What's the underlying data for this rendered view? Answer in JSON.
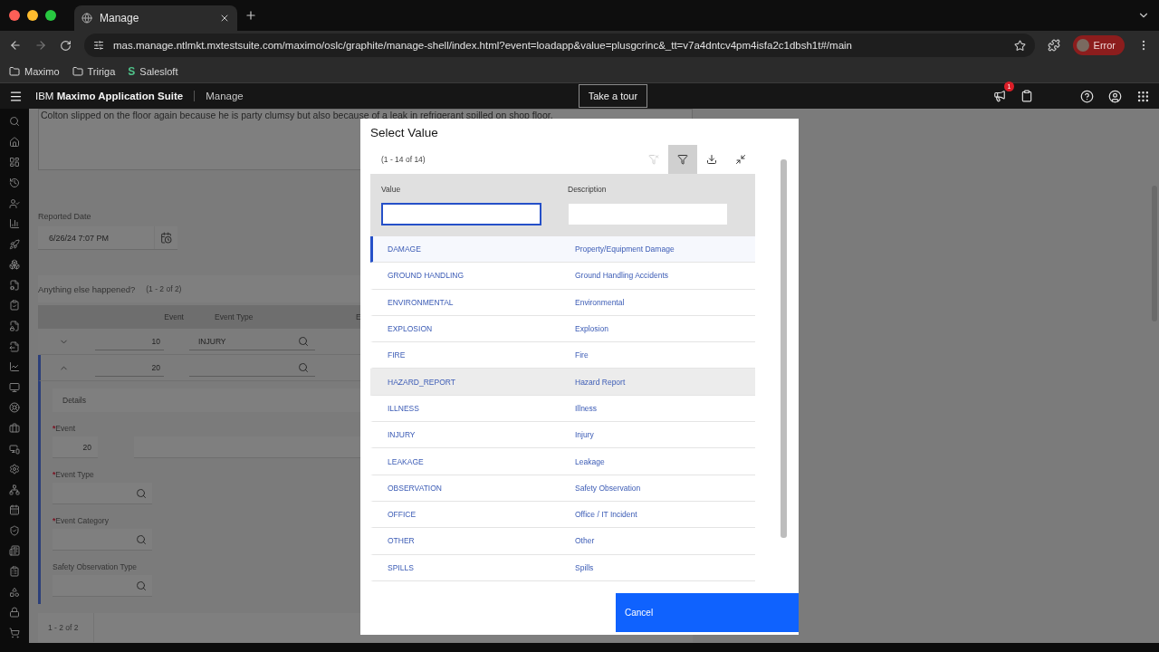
{
  "browser": {
    "tab_title": "Manage",
    "url": "mas.manage.ntlmkt.mxtestsuite.com/maximo/oslc/graphite/manage-shell/index.html?event=loadapp&value=plusgcrinc&_tt=v7a4dntcv4pm4isfa2c1dbsh1t#/main",
    "profile": "Error",
    "bookmarks": [
      {
        "kind": "folder",
        "label": "Maximo"
      },
      {
        "kind": "folder",
        "label": "Tririga"
      },
      {
        "kind": "site",
        "glyph": "S",
        "label": "Salesloft"
      }
    ]
  },
  "app_header": {
    "brand": "IBM **Maximo Application Suite**",
    "app": "Manage",
    "tour_button": "Take a tour",
    "notification_count": "1"
  },
  "form": {
    "description": "Colton slipped on the floor again because he is party clumsy but also because of a leak in refrigerant spilled on shop floor.",
    "reported_date": {
      "label": "Reported Date",
      "value": "6/26/24 7:07 PM"
    },
    "events": {
      "title": "Anything else happened?",
      "count": "(1 - 2 of 2)",
      "columns": [
        "Event",
        "Event Type",
        "E"
      ],
      "rows": [
        {
          "event": "10",
          "event_type": "INJURY",
          "expanded": false
        },
        {
          "event": "20",
          "event_type": "",
          "expanded": true
        }
      ],
      "details": {
        "title": "Details",
        "required_mark": "*",
        "fields": [
          {
            "kind": "number",
            "label": "Event",
            "required": true,
            "value": "20"
          },
          {
            "kind": "lookup",
            "label": "Event Type",
            "required": true
          },
          {
            "kind": "lookup",
            "label": "Event Category",
            "required": true
          },
          {
            "kind": "lookup",
            "label": "Safety Observation Type",
            "required": false
          }
        ]
      },
      "pagination": "1 - 2 of 2"
    }
  },
  "modal": {
    "title": "Select Value",
    "count": "(1 - 14 of 14)",
    "toolbar": [
      {
        "kind": "clear-filter",
        "disabled": true,
        "selected": false
      },
      {
        "kind": "filter",
        "disabled": false,
        "selected": true
      },
      {
        "kind": "download",
        "disabled": false,
        "selected": false
      },
      {
        "kind": "collapse",
        "disabled": false,
        "selected": false
      }
    ],
    "filters": [
      {
        "label": "Value",
        "focused": true
      },
      {
        "label": "Description",
        "focused": false
      }
    ],
    "rows": [
      {
        "value": "DAMAGE",
        "description": "Property/Equipment Damage",
        "selected": true,
        "hovered": false
      },
      {
        "value": "GROUND HANDLING",
        "description": "Ground Handling Accidents",
        "selected": false,
        "hovered": false
      },
      {
        "value": "ENVIRONMENTAL",
        "description": "Environmental",
        "selected": false,
        "hovered": false
      },
      {
        "value": "EXPLOSION",
        "description": "Explosion",
        "selected": false,
        "hovered": false
      },
      {
        "value": "FIRE",
        "description": "Fire",
        "selected": false,
        "hovered": false
      },
      {
        "value": "HAZARD_REPORT",
        "description": "Hazard Report",
        "selected": false,
        "hovered": true
      },
      {
        "value": "ILLNESS",
        "description": "Illness",
        "selected": false,
        "hovered": false
      },
      {
        "value": "INJURY",
        "description": "Injury",
        "selected": false,
        "hovered": false
      },
      {
        "value": "LEAKAGE",
        "description": "Leakage",
        "selected": false,
        "hovered": false
      },
      {
        "value": "OBSERVATION",
        "description": "Safety Observation",
        "selected": false,
        "hovered": false
      },
      {
        "value": "OFFICE",
        "description": "Office / IT Incident",
        "selected": false,
        "hovered": false
      },
      {
        "value": "OTHER",
        "description": "Other",
        "selected": false,
        "hovered": false
      },
      {
        "value": "SPILLS",
        "description": "Spills",
        "selected": false,
        "hovered": false
      }
    ],
    "cancel_button": "Cancel"
  }
}
